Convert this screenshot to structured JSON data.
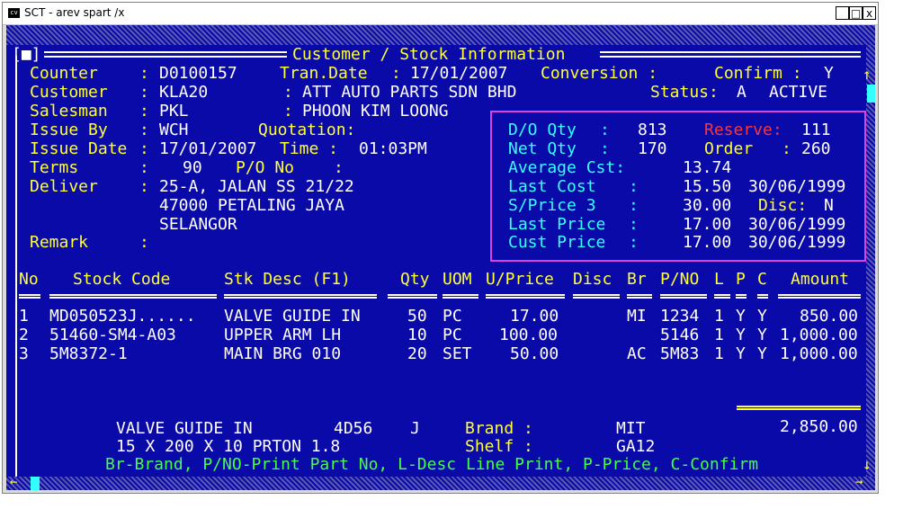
{
  "window": {
    "title": "SCT - arev spart /x",
    "icon_label": "cv",
    "minimize": "_",
    "maximize": "□",
    "close": "x"
  },
  "screen": {
    "title": "Customer / Stock Information",
    "menu_box": "[■]",
    "scroll_up": "↑",
    "scroll_down": "↓",
    "scroll_left": "←",
    "scroll_right": "→",
    "header": {
      "counter_label": "Counter",
      "counter_value": "D0100157",
      "tran_date_label": "Tran.Date",
      "tran_date_value": "17/01/2007",
      "conversion_label": "Conversion :",
      "confirm_label": "Confirm :",
      "confirm_value": "Y",
      "customer_label": "Customer",
      "customer_value": "KLA20",
      "customer_name": "ATT AUTO PARTS SDN BHD",
      "status_label": "Status:",
      "status_value": "A",
      "status_text": "ACTIVE",
      "salesman_label": "Salesman",
      "salesman_value": "PKL",
      "salesman_name": "PHOON KIM LOONG",
      "issue_by_label": "Issue By",
      "issue_by_value": "WCH",
      "quotation_label": "Quotation:",
      "issue_date_label": "Issue Date",
      "issue_date_value": "17/01/2007",
      "time_label": "Time :",
      "time_value": "01:03PM",
      "terms_label": "Terms",
      "terms_value": "90",
      "po_label": "P/O No",
      "po_colon": ":",
      "deliver_label": "Deliver",
      "deliver_line1": "25-A, JALAN SS 21/22",
      "deliver_line2": "47000 PETALING JAYA",
      "deliver_line3": "SELANGOR",
      "remark_label": "Remark",
      "colon": ":"
    },
    "info": {
      "do_qty_label": "D/O Qty",
      "do_qty_value": "813",
      "reserve_label": "Reserve:",
      "reserve_value": "111",
      "net_qty_label": "Net Qty",
      "net_qty_value": "170",
      "order_label": "Order",
      "order_value": "260",
      "avg_cost_label": "Average Cst:",
      "avg_cost_value": "13.74",
      "last_cost_label": "Last Cost",
      "last_cost_value": "15.50",
      "last_cost_date": "30/06/1999",
      "sprice_label": "S/Price 3",
      "sprice_value": "30.00",
      "disc_label": "Disc:",
      "disc_value": "N",
      "last_price_label": "Last Price",
      "last_price_value": "17.00",
      "last_price_date": "30/06/1999",
      "cust_price_label": "Cust Price",
      "cust_price_value": "17.00",
      "cust_price_date": "30/06/1999",
      "colon": ":"
    },
    "table": {
      "headers": {
        "no": "No",
        "stock_code": "Stock Code",
        "desc": "Stk Desc (F1)",
        "qty": "Qty",
        "uom": "UOM",
        "uprice": "U/Price",
        "disc": "Disc",
        "br": "Br",
        "pno": "P/NO",
        "l": "L",
        "p": "P",
        "c": "C",
        "amount": "Amount"
      },
      "rows": [
        {
          "no": "1",
          "code": "MD050523J......",
          "desc": "VALVE GUIDE IN",
          "qty": "50",
          "uom": "PC",
          "uprice": "17.00",
          "disc": "",
          "br": "MI",
          "pno": "1234",
          "l": "1",
          "p": "Y",
          "c": "Y",
          "amount": "850.00"
        },
        {
          "no": "2",
          "code": "51460-SM4-A03",
          "desc": "UPPER ARM LH",
          "qty": "10",
          "uom": "PC",
          "uprice": "100.00",
          "disc": "",
          "br": "",
          "pno": "5146",
          "l": "1",
          "p": "Y",
          "c": "Y",
          "amount": "1,000.00"
        },
        {
          "no": "3",
          "code": "5M8372-1",
          "desc": "MAIN BRG 010",
          "qty": "20",
          "uom": "SET",
          "uprice": "50.00",
          "disc": "",
          "br": "AC",
          "pno": "5M83",
          "l": "1",
          "p": "Y",
          "c": "Y",
          "amount": "1,000.00"
        }
      ],
      "total": "2,850.00"
    },
    "detail": {
      "desc_line1": "VALVE GUIDE IN",
      "code1": "4D56",
      "flag1": "J",
      "desc_line2": "15 X 200 X 10 PRTON 1.8",
      "brand_label": "Brand :",
      "brand_value": "MIT",
      "shelf_label": "Shelf :",
      "shelf_value": "GA12"
    },
    "hint": "Br-Brand, P/NO-Print Part No, L-Desc Line Print, P-Price, C-Confirm"
  },
  "colors": {
    "background": "#0a0aa8",
    "label": "#ffff33",
    "value": "#ffffff",
    "info_label": "#33ffff",
    "reserve": "#ff3333",
    "hint": "#44ff44",
    "info_border": "#e040e0"
  }
}
